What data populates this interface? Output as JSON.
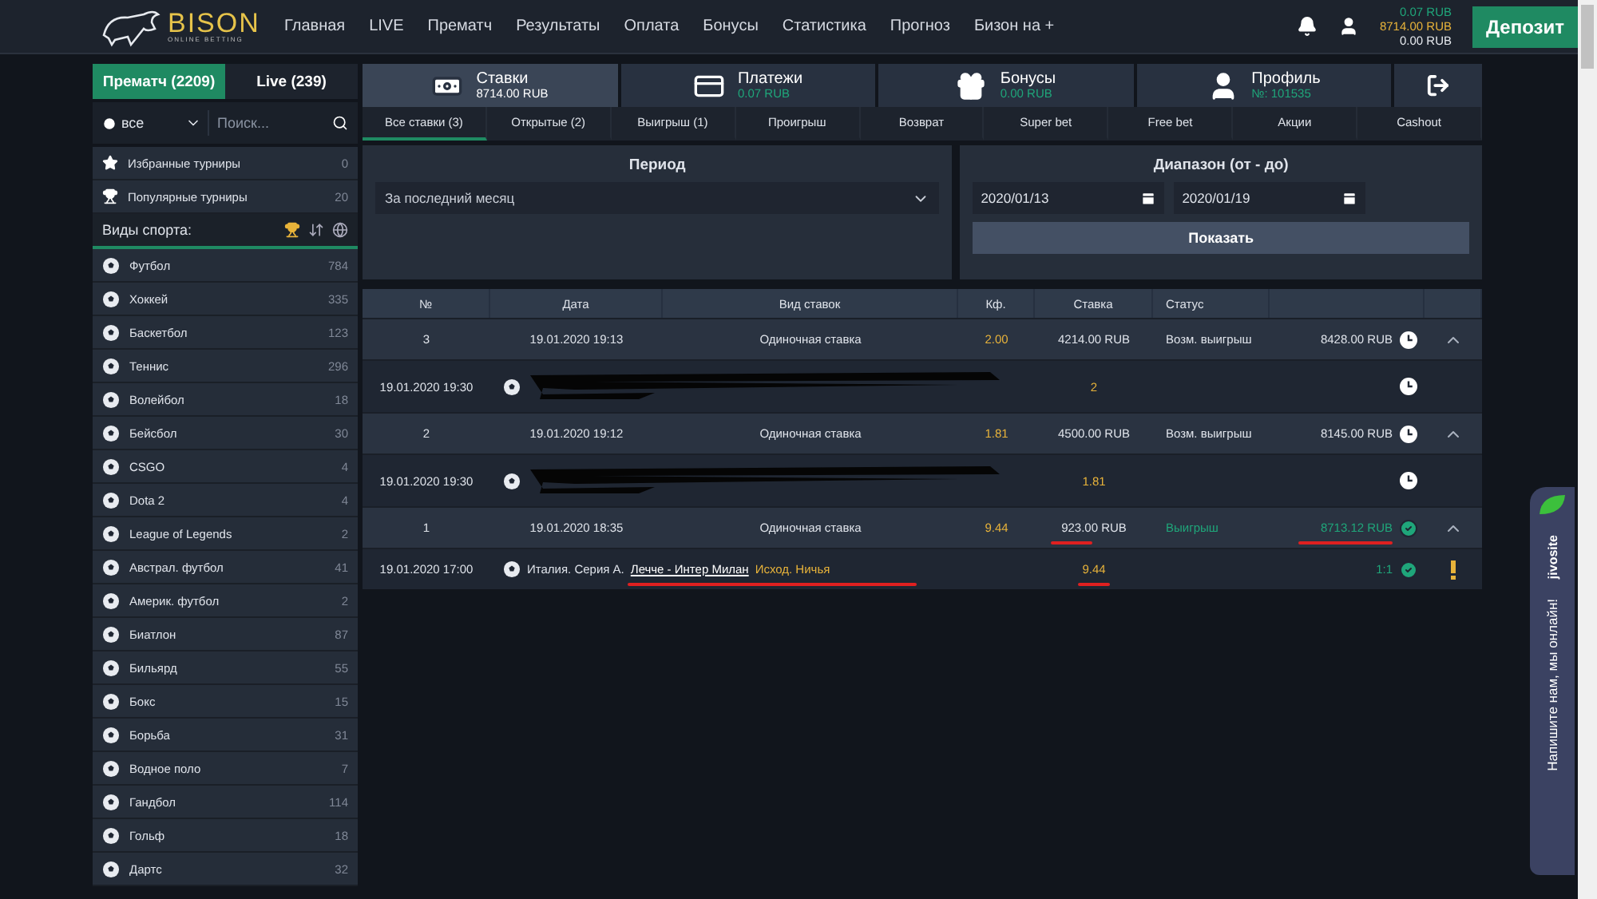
{
  "header": {
    "logo": "BISON",
    "tagline": "ONLINE BETTING",
    "nav": [
      "Главная",
      "LIVE",
      "Прематч",
      "Результаты",
      "Оплата",
      "Бонусы",
      "Статистика",
      "Прогноз",
      "Бизон на +"
    ],
    "balances": [
      {
        "amount": "0.07 RUB",
        "color": "#1fa67a"
      },
      {
        "amount": "8714.00 RUB",
        "color": "#e8b33a"
      },
      {
        "amount": "0.00 RUB",
        "color": "#e6e9ee"
      }
    ],
    "deposit": "Депозит"
  },
  "sidebar": {
    "tabs": [
      {
        "label": "Прематч (2209)",
        "selected": true
      },
      {
        "label": "Live (239)",
        "selected": false
      }
    ],
    "filter": "все",
    "search_placeholder": "Поиск...",
    "tournaments": [
      {
        "label": "Избранные турниры",
        "count": "0",
        "kind": "star"
      },
      {
        "label": "Популярные турниры",
        "count": "20",
        "kind": "trophy"
      }
    ],
    "sports_heading": "Виды спорта:",
    "sports": [
      {
        "name": "Футбол",
        "count": "784"
      },
      {
        "name": "Хоккей",
        "count": "335"
      },
      {
        "name": "Баскетбол",
        "count": "123"
      },
      {
        "name": "Теннис",
        "count": "296"
      },
      {
        "name": "Волейбол",
        "count": "18"
      },
      {
        "name": "Бейсбол",
        "count": "30"
      },
      {
        "name": "CSGO",
        "count": "4"
      },
      {
        "name": "Dota 2",
        "count": "4"
      },
      {
        "name": "League of Legends",
        "count": "2"
      },
      {
        "name": "Австрал. футбол",
        "count": "41"
      },
      {
        "name": "Америк. футбол",
        "count": "2"
      },
      {
        "name": "Биатлон",
        "count": "87"
      },
      {
        "name": "Бильярд",
        "count": "55"
      },
      {
        "name": "Бокс",
        "count": "15"
      },
      {
        "name": "Борьба",
        "count": "31"
      },
      {
        "name": "Водное поло",
        "count": "7"
      },
      {
        "name": "Гандбол",
        "count": "114"
      },
      {
        "name": "Гольф",
        "count": "18"
      },
      {
        "name": "Дартс",
        "count": "32"
      }
    ]
  },
  "account_tabs": [
    {
      "title": "Ставки",
      "value": "8714.00 RUB",
      "kind": "bets",
      "selected": true
    },
    {
      "title": "Платежи",
      "value": "0.07 RUB",
      "kind": "payments",
      "selected": false
    },
    {
      "title": "Бонусы",
      "value": "0.00 RUB",
      "kind": "bonuses",
      "selected": false
    },
    {
      "title": "Профиль",
      "value": "№: 101535",
      "kind": "profile",
      "selected": false
    }
  ],
  "bet_filters": [
    {
      "label": "Все ставки (3)",
      "selected": true
    },
    {
      "label": "Открытые (2)",
      "selected": false
    },
    {
      "label": "Выигрыш (1)",
      "selected": false
    },
    {
      "label": "Проигрыш",
      "selected": false
    },
    {
      "label": "Возврат",
      "selected": false
    },
    {
      "label": "Super bet",
      "selected": false
    },
    {
      "label": "Free bet",
      "selected": false
    },
    {
      "label": "Акции",
      "selected": false
    },
    {
      "label": "Cashout",
      "selected": false
    }
  ],
  "period": {
    "heading": "Период",
    "value": "За последний месяц"
  },
  "range": {
    "heading": "Диапазон (от - до)",
    "from": "2020/01/13",
    "to": "2020/01/19",
    "button": "Показать"
  },
  "table": {
    "columns": [
      "№",
      "Дата",
      "Вид ставок",
      "Кф.",
      "Ставка",
      "Статус"
    ],
    "bets": [
      {
        "number": "3",
        "date": "19.01.2020 19:13",
        "type": "Одиночная ставка",
        "odds": "2.00",
        "stake": "4214.00 RUB",
        "status": "Возм. выигрыш",
        "payout": "8428.00 RUB",
        "won": false,
        "marked": false,
        "expanded": true,
        "events": [
          {
            "date": "19.01.2020 19:30",
            "redacted": true,
            "odds": "2",
            "won": false,
            "marked": false,
            "warning": false
          }
        ]
      },
      {
        "number": "2",
        "date": "19.01.2020 19:12",
        "type": "Одиночная ставка",
        "odds": "1.81",
        "stake": "4500.00 RUB",
        "status": "Возм. выигрыш",
        "payout": "8145.00 RUB",
        "won": false,
        "marked": false,
        "expanded": true,
        "events": [
          {
            "date": "19.01.2020 19:30",
            "redacted": true,
            "odds": "1.81",
            "won": false,
            "marked": false,
            "warning": false
          }
        ]
      },
      {
        "number": "1",
        "date": "19.01.2020 18:35",
        "type": "Одиночная ставка",
        "odds": "9.44",
        "stake": "923.00 RUB",
        "status": "Выигрыш",
        "payout": "8713.12 RUB",
        "won": true,
        "marked": true,
        "expanded": true,
        "events": [
          {
            "date": "19.01.2020 17:00",
            "redacted": false,
            "league": "Италия. Серия А.",
            "match": "Лечче - Интер Милан",
            "outcome": "Исход. Ничья",
            "odds": "9.44",
            "score": "1:1",
            "won": true,
            "marked": true,
            "warning": true
          }
        ]
      }
    ]
  },
  "chat": {
    "brand": "jivosite",
    "message": "Напишите нам, мы онлайн!"
  }
}
